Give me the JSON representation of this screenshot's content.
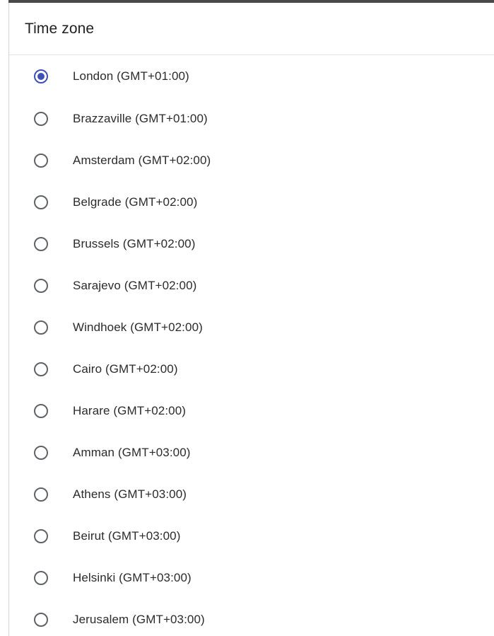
{
  "dialog": {
    "title": "Time zone"
  },
  "timezones": [
    {
      "label": "London (GMT+01:00)",
      "selected": true
    },
    {
      "label": "Brazzaville (GMT+01:00)",
      "selected": false
    },
    {
      "label": "Amsterdam (GMT+02:00)",
      "selected": false
    },
    {
      "label": "Belgrade (GMT+02:00)",
      "selected": false
    },
    {
      "label": "Brussels (GMT+02:00)",
      "selected": false
    },
    {
      "label": "Sarajevo (GMT+02:00)",
      "selected": false
    },
    {
      "label": "Windhoek (GMT+02:00)",
      "selected": false
    },
    {
      "label": "Cairo (GMT+02:00)",
      "selected": false
    },
    {
      "label": "Harare (GMT+02:00)",
      "selected": false
    },
    {
      "label": "Amman (GMT+03:00)",
      "selected": false
    },
    {
      "label": "Athens (GMT+03:00)",
      "selected": false
    },
    {
      "label": "Beirut (GMT+03:00)",
      "selected": false
    },
    {
      "label": "Helsinki (GMT+03:00)",
      "selected": false
    },
    {
      "label": "Jerusalem (GMT+03:00)",
      "selected": false
    }
  ],
  "colors": {
    "accent": "#3f51b5",
    "radio_unchecked": "#5f6368",
    "text": "#2b2b2b"
  }
}
